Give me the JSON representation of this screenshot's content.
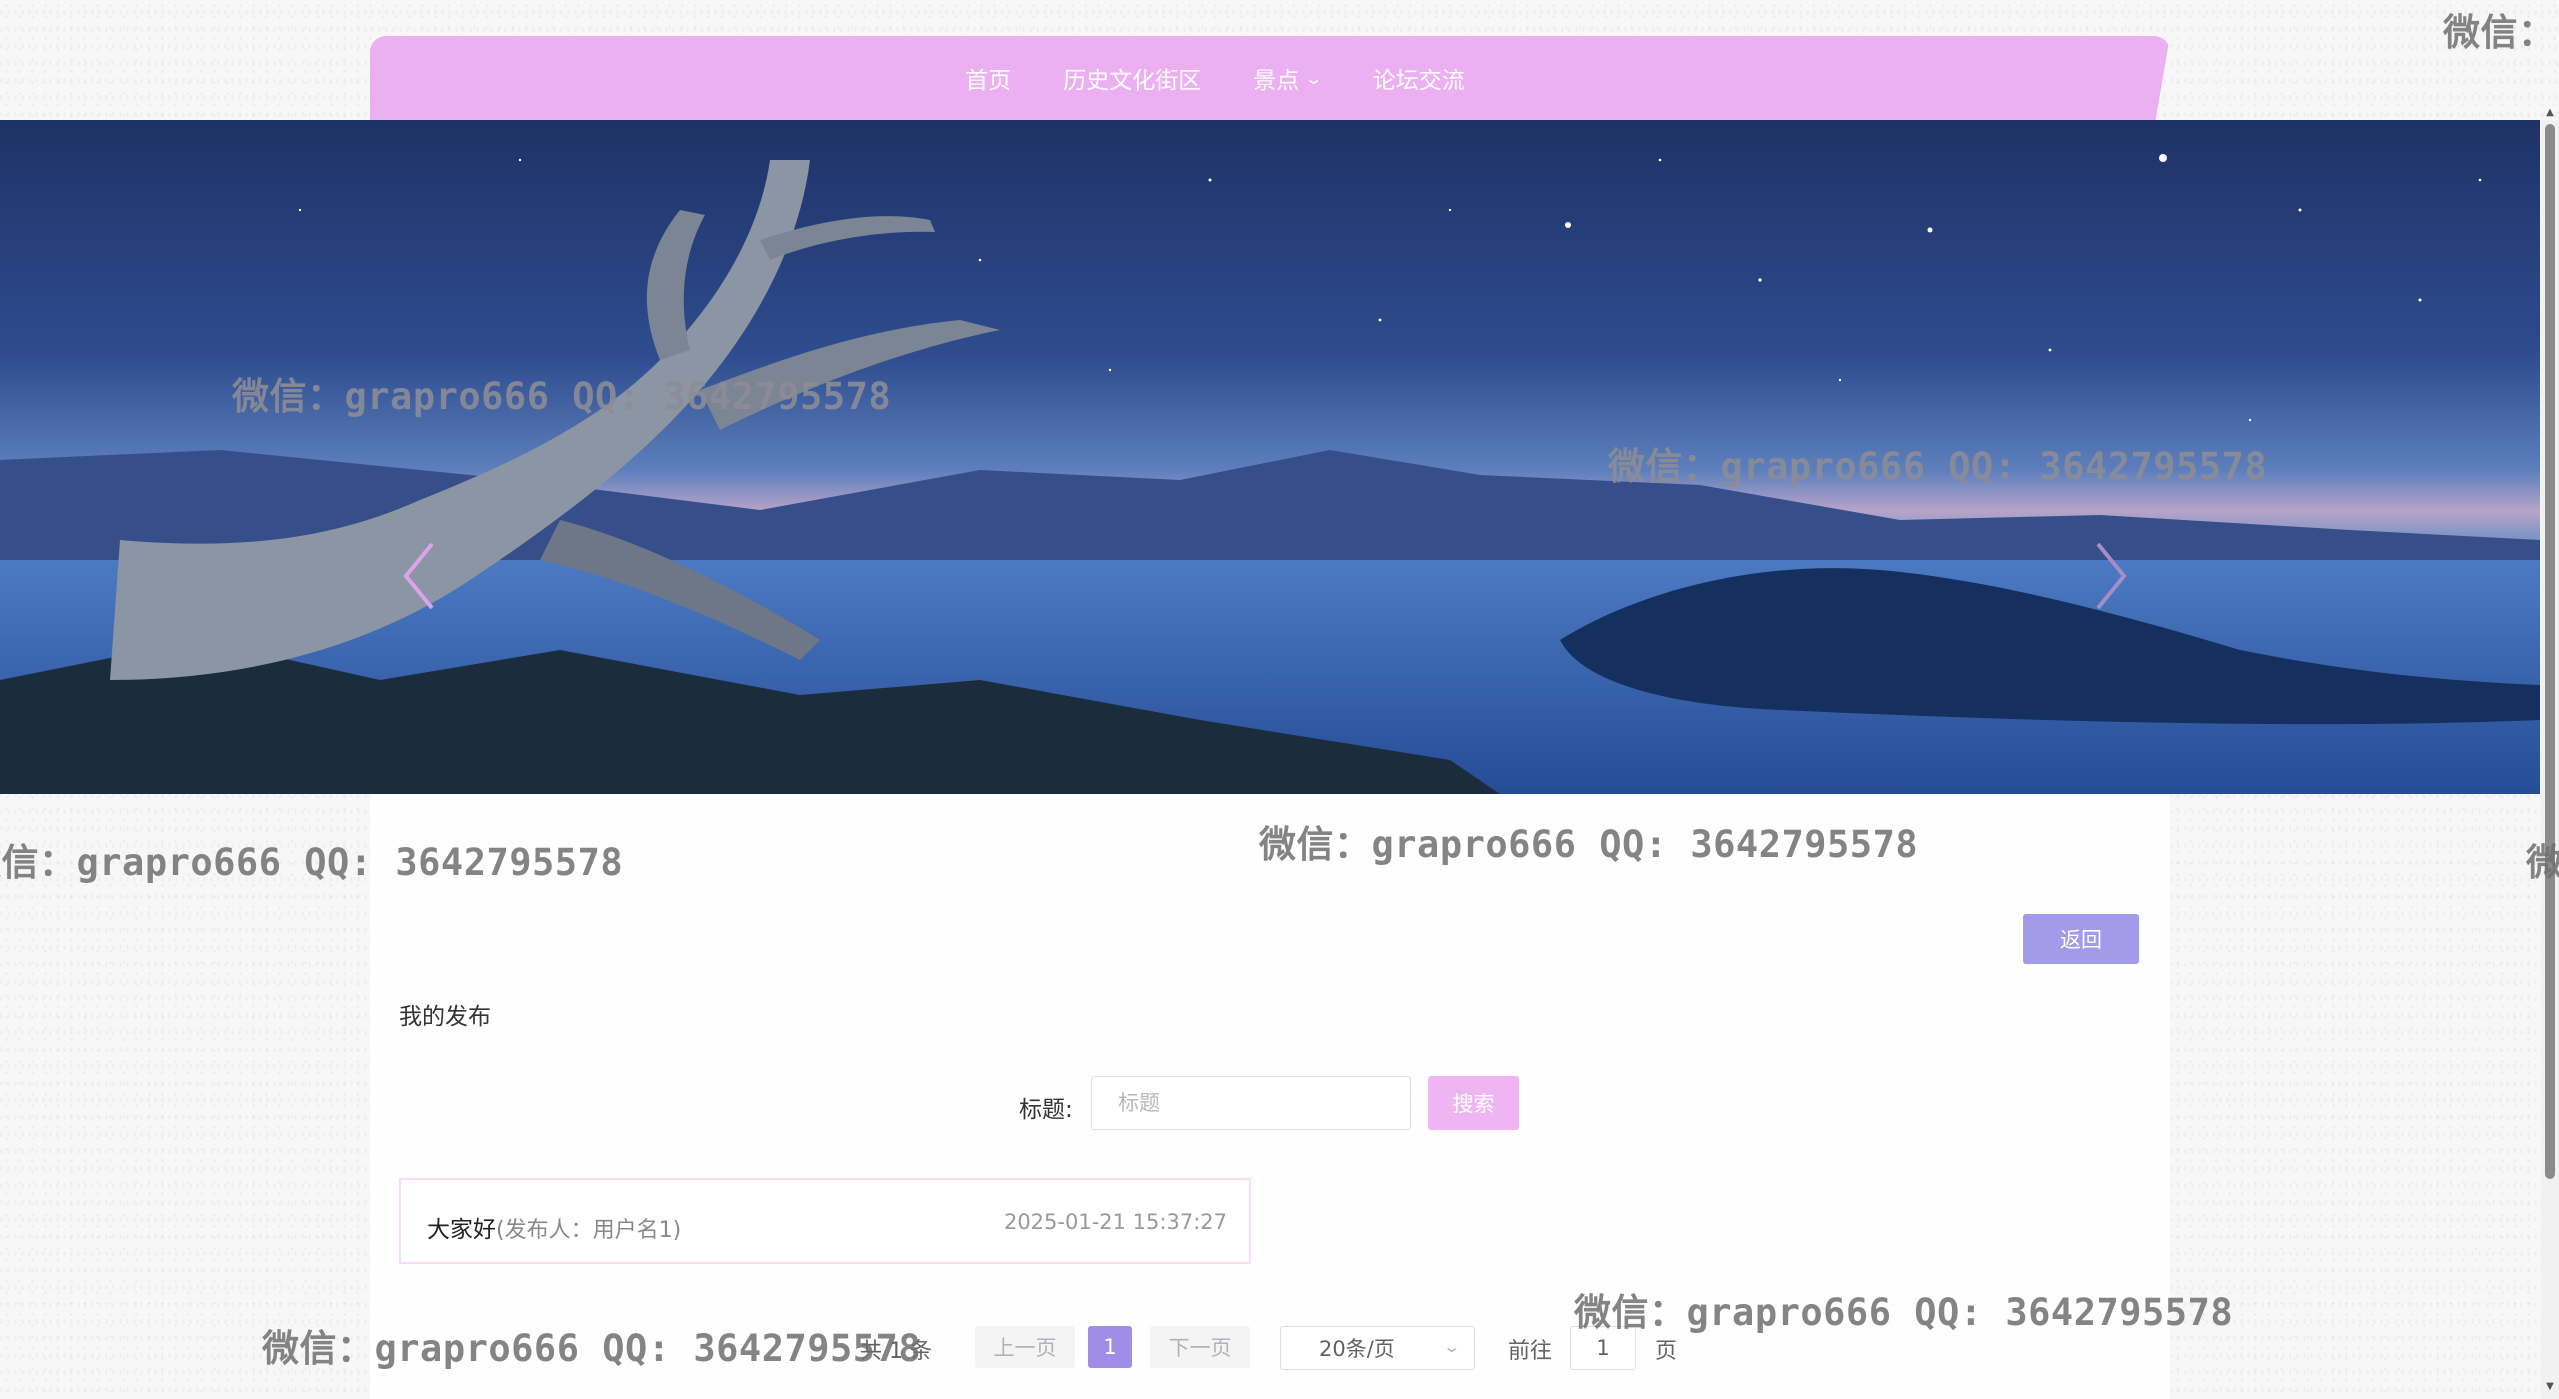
{
  "nav": {
    "items": [
      {
        "label": "首页"
      },
      {
        "label": "历史文化街区"
      },
      {
        "label": "景点"
      },
      {
        "label": "论坛交流"
      }
    ]
  },
  "content": {
    "back_label": "返回",
    "section_title": "我的发布",
    "search": {
      "label": "标题:",
      "placeholder": "标题",
      "button_label": "搜索"
    },
    "posts": [
      {
        "title": "大家好",
        "author": "(发布人：用户名1)",
        "time": "2025-01-21 15:37:27"
      }
    ],
    "pagination": {
      "total": "共 1 条",
      "prev": "上一页",
      "current_page": "1",
      "next": "下一页",
      "page_size": "20条/页",
      "goto_label": "前往",
      "goto_value": "1",
      "page_suffix": "页"
    }
  },
  "watermark": {
    "text": "微信：grapro666 QQ: 3642795578",
    "corner_text": "微信：",
    "edge_text": "微"
  },
  "colors": {
    "nav_bg": "#ecb0f2",
    "back_button": "#a49aea",
    "search_button": "#efb5f3",
    "active_page": "#9f8ee8"
  }
}
